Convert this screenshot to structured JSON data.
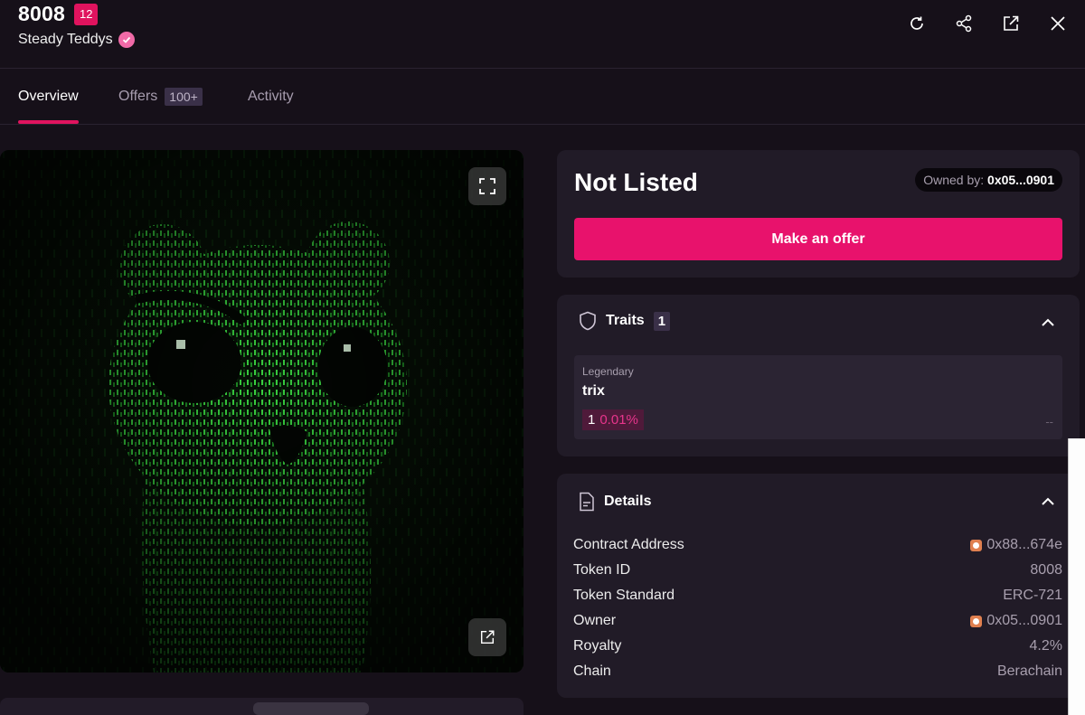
{
  "header": {
    "token_number": "8008",
    "rank": "12",
    "collection": "Steady Teddys",
    "actions": [
      "refresh-icon",
      "share-icon",
      "external-link-icon",
      "close-icon"
    ]
  },
  "tabs": [
    {
      "label": "Overview",
      "active": true
    },
    {
      "label": "Offers",
      "count": "100+"
    },
    {
      "label": "Activity"
    }
  ],
  "listing": {
    "status": "Not Listed",
    "owned_by_label": "Owned by:",
    "owner": "0x05...0901",
    "offer_button": "Make an offer"
  },
  "traits": {
    "title": "Traits",
    "count": "1",
    "items": [
      {
        "type": "Legendary",
        "value": "trix",
        "count": "1",
        "percent": "0.01%",
        "price": "--"
      }
    ]
  },
  "details": {
    "title": "Details",
    "rows": [
      {
        "label": "Contract Address",
        "value": "0x88...674e",
        "icon": true
      },
      {
        "label": "Token ID",
        "value": "8008"
      },
      {
        "label": "Token Standard",
        "value": "ERC-721"
      },
      {
        "label": "Owner",
        "value": "0x05...0901",
        "icon": true
      },
      {
        "label": "Royalty",
        "value": "4.2%"
      },
      {
        "label": "Chain",
        "value": "Berachain"
      }
    ]
  },
  "colors": {
    "accent": "#e8126c",
    "background": "#161019",
    "panel": "#211b27"
  }
}
